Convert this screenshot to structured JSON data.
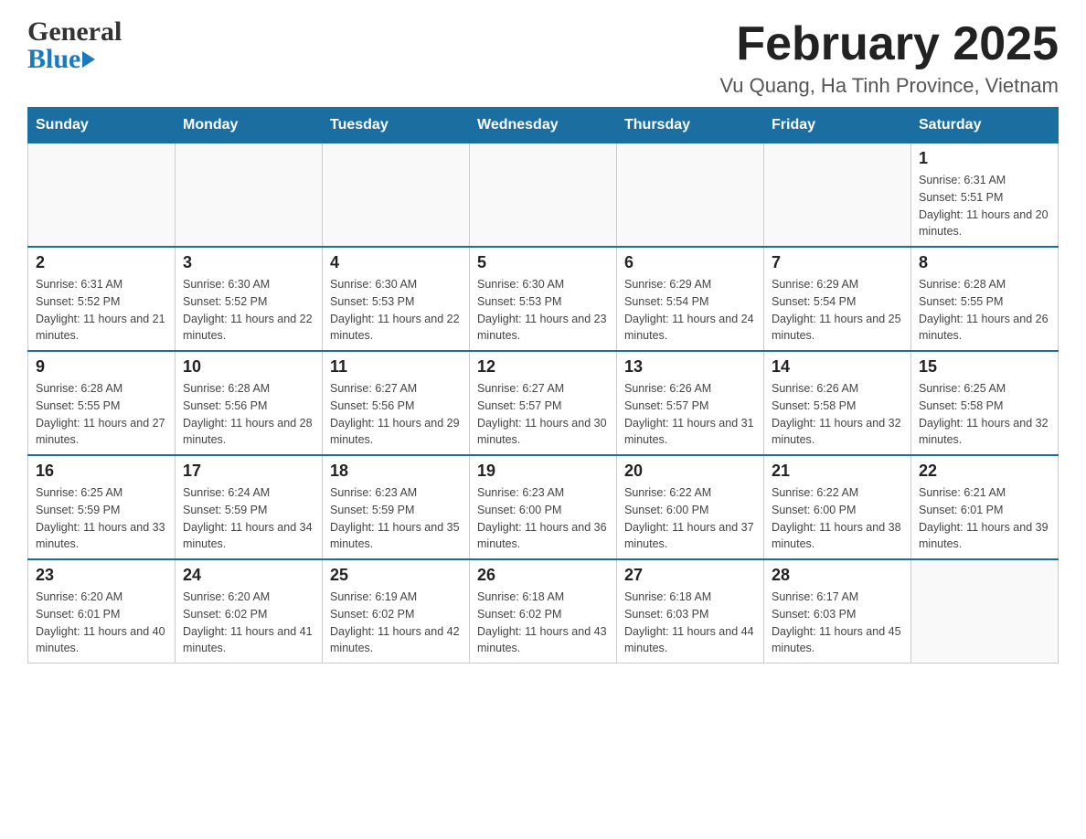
{
  "header": {
    "logo_line1": "General",
    "logo_line2": "Blue",
    "title": "February 2025",
    "subtitle": "Vu Quang, Ha Tinh Province, Vietnam"
  },
  "days_of_week": [
    "Sunday",
    "Monday",
    "Tuesday",
    "Wednesday",
    "Thursday",
    "Friday",
    "Saturday"
  ],
  "weeks": [
    {
      "days": [
        {
          "date": "",
          "info": ""
        },
        {
          "date": "",
          "info": ""
        },
        {
          "date": "",
          "info": ""
        },
        {
          "date": "",
          "info": ""
        },
        {
          "date": "",
          "info": ""
        },
        {
          "date": "",
          "info": ""
        },
        {
          "date": "1",
          "info": "Sunrise: 6:31 AM\nSunset: 5:51 PM\nDaylight: 11 hours and 20 minutes."
        }
      ]
    },
    {
      "days": [
        {
          "date": "2",
          "info": "Sunrise: 6:31 AM\nSunset: 5:52 PM\nDaylight: 11 hours and 21 minutes."
        },
        {
          "date": "3",
          "info": "Sunrise: 6:30 AM\nSunset: 5:52 PM\nDaylight: 11 hours and 22 minutes."
        },
        {
          "date": "4",
          "info": "Sunrise: 6:30 AM\nSunset: 5:53 PM\nDaylight: 11 hours and 22 minutes."
        },
        {
          "date": "5",
          "info": "Sunrise: 6:30 AM\nSunset: 5:53 PM\nDaylight: 11 hours and 23 minutes."
        },
        {
          "date": "6",
          "info": "Sunrise: 6:29 AM\nSunset: 5:54 PM\nDaylight: 11 hours and 24 minutes."
        },
        {
          "date": "7",
          "info": "Sunrise: 6:29 AM\nSunset: 5:54 PM\nDaylight: 11 hours and 25 minutes."
        },
        {
          "date": "8",
          "info": "Sunrise: 6:28 AM\nSunset: 5:55 PM\nDaylight: 11 hours and 26 minutes."
        }
      ]
    },
    {
      "days": [
        {
          "date": "9",
          "info": "Sunrise: 6:28 AM\nSunset: 5:55 PM\nDaylight: 11 hours and 27 minutes."
        },
        {
          "date": "10",
          "info": "Sunrise: 6:28 AM\nSunset: 5:56 PM\nDaylight: 11 hours and 28 minutes."
        },
        {
          "date": "11",
          "info": "Sunrise: 6:27 AM\nSunset: 5:56 PM\nDaylight: 11 hours and 29 minutes."
        },
        {
          "date": "12",
          "info": "Sunrise: 6:27 AM\nSunset: 5:57 PM\nDaylight: 11 hours and 30 minutes."
        },
        {
          "date": "13",
          "info": "Sunrise: 6:26 AM\nSunset: 5:57 PM\nDaylight: 11 hours and 31 minutes."
        },
        {
          "date": "14",
          "info": "Sunrise: 6:26 AM\nSunset: 5:58 PM\nDaylight: 11 hours and 32 minutes."
        },
        {
          "date": "15",
          "info": "Sunrise: 6:25 AM\nSunset: 5:58 PM\nDaylight: 11 hours and 32 minutes."
        }
      ]
    },
    {
      "days": [
        {
          "date": "16",
          "info": "Sunrise: 6:25 AM\nSunset: 5:59 PM\nDaylight: 11 hours and 33 minutes."
        },
        {
          "date": "17",
          "info": "Sunrise: 6:24 AM\nSunset: 5:59 PM\nDaylight: 11 hours and 34 minutes."
        },
        {
          "date": "18",
          "info": "Sunrise: 6:23 AM\nSunset: 5:59 PM\nDaylight: 11 hours and 35 minutes."
        },
        {
          "date": "19",
          "info": "Sunrise: 6:23 AM\nSunset: 6:00 PM\nDaylight: 11 hours and 36 minutes."
        },
        {
          "date": "20",
          "info": "Sunrise: 6:22 AM\nSunset: 6:00 PM\nDaylight: 11 hours and 37 minutes."
        },
        {
          "date": "21",
          "info": "Sunrise: 6:22 AM\nSunset: 6:00 PM\nDaylight: 11 hours and 38 minutes."
        },
        {
          "date": "22",
          "info": "Sunrise: 6:21 AM\nSunset: 6:01 PM\nDaylight: 11 hours and 39 minutes."
        }
      ]
    },
    {
      "days": [
        {
          "date": "23",
          "info": "Sunrise: 6:20 AM\nSunset: 6:01 PM\nDaylight: 11 hours and 40 minutes."
        },
        {
          "date": "24",
          "info": "Sunrise: 6:20 AM\nSunset: 6:02 PM\nDaylight: 11 hours and 41 minutes."
        },
        {
          "date": "25",
          "info": "Sunrise: 6:19 AM\nSunset: 6:02 PM\nDaylight: 11 hours and 42 minutes."
        },
        {
          "date": "26",
          "info": "Sunrise: 6:18 AM\nSunset: 6:02 PM\nDaylight: 11 hours and 43 minutes."
        },
        {
          "date": "27",
          "info": "Sunrise: 6:18 AM\nSunset: 6:03 PM\nDaylight: 11 hours and 44 minutes."
        },
        {
          "date": "28",
          "info": "Sunrise: 6:17 AM\nSunset: 6:03 PM\nDaylight: 11 hours and 45 minutes."
        },
        {
          "date": "",
          "info": ""
        }
      ]
    }
  ]
}
